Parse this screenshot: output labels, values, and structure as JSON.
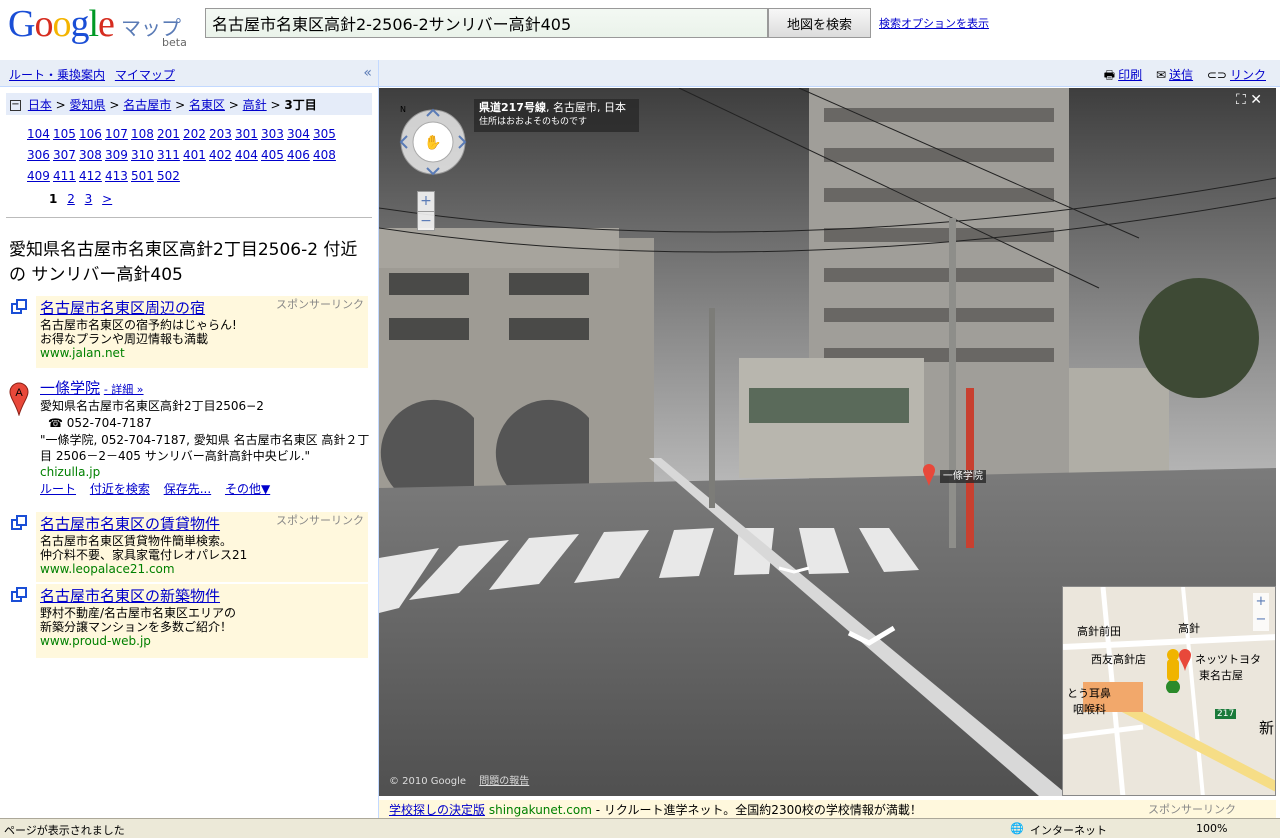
{
  "header": {
    "logo_text": "Google",
    "logo_maps": "マップ",
    "logo_beta": "beta",
    "search_value": "名古屋市名東区高針2-2506-2サンリバー高針405",
    "search_button": "地図を検索",
    "search_options": "検索オプションを表示"
  },
  "leftnav": {
    "route": "ルート・乗換案内",
    "mymaps": "マイマップ",
    "collapse": "«"
  },
  "breadcrumb": [
    "日本",
    "愛知県",
    "名古屋市",
    "名東区",
    "高針",
    "3丁目"
  ],
  "subareas": [
    "104",
    "105",
    "106",
    "107",
    "108",
    "201",
    "202",
    "203",
    "301",
    "303",
    "304",
    "305",
    "306",
    "307",
    "308",
    "309",
    "310",
    "311",
    "401",
    "402",
    "404",
    "405",
    "406",
    "408",
    "409",
    "411",
    "412",
    "413",
    "501",
    "502"
  ],
  "pager": [
    "1",
    "2",
    "3",
    ">"
  ],
  "result_title": "愛知県名古屋市名東区高針2丁目2506-2 付近の サンリバー高針405",
  "ads": [
    {
      "title": "名古屋市名東区周辺の宿",
      "line1": "名古屋市名東区の宿予約はじゃらん!",
      "line2": "お得なプランや周辺情報も満載",
      "url": "www.jalan.net",
      "sponsor": "スポンサーリンク"
    },
    {
      "title": "名古屋市名東区の賃貸物件",
      "line1": "名古屋市名東区賃貸物件簡単検索。",
      "line2": "仲介料不要、家具家電付レオパレス21",
      "url": "www.leopalace21.com",
      "sponsor": "スポンサーリンク"
    },
    {
      "title": "名古屋市名東区の新築物件",
      "line1": "野村不動産/名古屋市名東区エリアの",
      "line2": "新築分譲マンションを多数ご紹介！",
      "url": "www.proud-web.jp",
      "sponsor": ""
    }
  ],
  "result": {
    "marker": "A",
    "name": "一條学院",
    "detail": "- 詳細 »",
    "address": "愛知県名古屋市名東区高針2丁目2506−2",
    "phone": "052-704-7187",
    "snippet": "\"一條学院, 052-704-7187, 愛知県 名古屋市名東区 高針２丁目 2506－2－405 サンリバー高針高針中央ビル.\"",
    "source": "chizulla.jp",
    "links": [
      "ルート",
      "付近を検索",
      "保存先...",
      "その他▼"
    ]
  },
  "viewbar": {
    "print": "印刷",
    "send": "送信",
    "link": "リンク"
  },
  "streetview": {
    "road": "県道217号線",
    "road_place": ", 名古屋市, 日本",
    "road_note": "住所はおおよそのものです",
    "pin_label": "一條学院",
    "copyright": "© 2010 Google",
    "report": "問題の報告"
  },
  "minimap": {
    "labels": [
      "高針前田",
      "高針",
      "西友高針店",
      "ネッツトヨタ",
      "東名古屋",
      "とう耳鼻",
      "咽喉科",
      "217",
      "新"
    ]
  },
  "bottomad": {
    "title": "学校探しの決定版",
    "url": "shingakunet.com",
    "text": "- リクルート進学ネット。全国約2300校の学校情報が満載！",
    "sponsor": "スポンサーリンク"
  },
  "status": {
    "text": "ページが表示されました",
    "zone": "インターネット",
    "zoom": "100%"
  }
}
